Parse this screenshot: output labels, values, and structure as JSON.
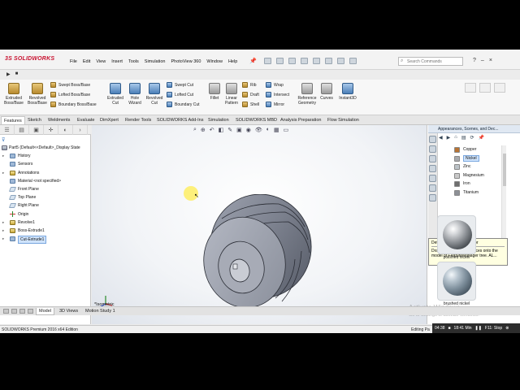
{
  "app": {
    "logo_prefix": "3S",
    "logo_text": "SOLIDWORKS",
    "menu": [
      "File",
      "Edit",
      "View",
      "Insert",
      "Tools",
      "Simulation",
      "PhotoView 360",
      "Window",
      "Help"
    ],
    "search_placeholder": "Search Commands"
  },
  "commands": {
    "extruded_boss": "Extruded Boss/Base",
    "revolved_boss": "Revolved Boss/Base",
    "swept_boss": "Swept Boss/Base",
    "lofted_boss": "Lofted Boss/Base",
    "boundary_boss": "Boundary Boss/Base",
    "extruded_cut": "Extruded Cut",
    "hole_wizard": "Hole Wizard",
    "revolved_cut": "Revolved Cut",
    "swept_cut": "Swept Cut",
    "lofted_cut": "Lofted Cut",
    "boundary_cut": "Boundary Cut",
    "fillet": "Fillet",
    "linear_pattern": "Linear Pattern",
    "rib": "Rib",
    "draft": "Draft",
    "shell": "Shell",
    "wrap": "Wrap",
    "intersect": "Intersect",
    "mirror": "Mirror",
    "reference_geometry": "Reference Geometry",
    "curves": "Curves",
    "instant3d": "Instant3D"
  },
  "tabs": [
    "Features",
    "Sketch",
    "Weldments",
    "Evaluate",
    "DimXpert",
    "Render Tools",
    "SOLIDWORKS Add-Ins",
    "Simulation",
    "SOLIDWORKS MBD",
    "Analysis Preparation",
    "Flow Simulation"
  ],
  "tree": {
    "root": "Part5  (Default<<Default>_Display State",
    "items": [
      "History",
      "Sensors",
      "Annotations",
      "Material <not specified>",
      "Front Plane",
      "Top Plane",
      "Right Plane",
      "Origin",
      "Revolve1",
      "Boss-Extrude1",
      "Cut-Extrude1"
    ]
  },
  "viewport": {
    "view_label": "*Isometric"
  },
  "task_pane": {
    "title": "Appearances, Scenes, and Dec...",
    "materials": [
      {
        "name": "Copper",
        "color": "#b87333"
      },
      {
        "name": "Nickel",
        "color": "#a7a9ad"
      },
      {
        "name": "Zinc",
        "color": "#bcc3c8"
      },
      {
        "name": "Magnesium",
        "color": "#c9c9c9"
      },
      {
        "name": "Iron",
        "color": "#6f6f6f"
      },
      {
        "name": "Titanium",
        "color": "#8d9096"
      }
    ],
    "tooltip_title": "Default Appearance: color",
    "tooltip_body": "Drag and drop appearances onto the model or FeatureManager tree.  AL...",
    "swatches": [
      "polished nickel",
      "brushed nickel"
    ]
  },
  "bottom_tabs": [
    "Model",
    "3D Views",
    "Motion Study 1"
  ],
  "status": {
    "left": "SOLIDWORKS Premium 2016 x64 Edition",
    "right": "Editing Pa"
  },
  "video": {
    "elapsed": "04:38",
    "total": "18:41 Min",
    "label": "F11: Stop"
  },
  "watermark": {
    "line1": "Activate Windows",
    "line2": "Go to Settings to activate Windows."
  }
}
